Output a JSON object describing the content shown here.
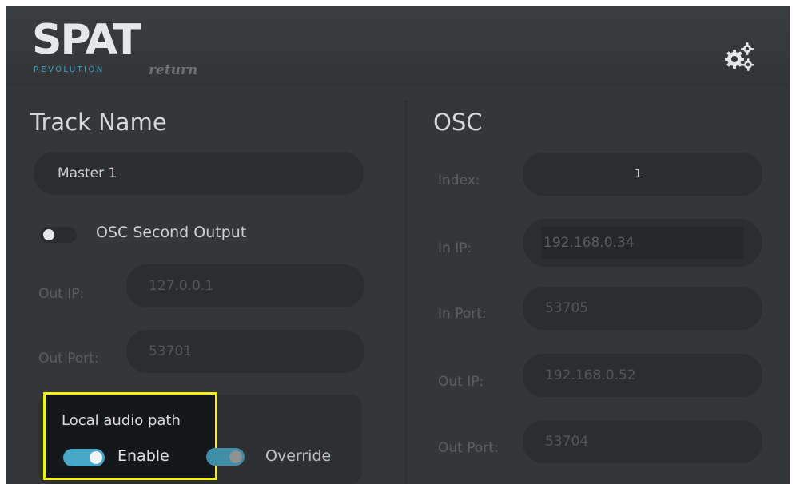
{
  "header": {
    "logo_main": "SPAT",
    "logo_sub": "REVOLUTION",
    "logo_return": "return",
    "settings_icon": "gears-icon"
  },
  "left": {
    "heading": "Track Name",
    "track_name_value": "Master 1",
    "osc_second_output": {
      "label": "OSC Second Output",
      "enabled": false
    },
    "out_ip": {
      "label": "Out IP:",
      "value": "127.0.0.1"
    },
    "out_port": {
      "label": "Out Port:",
      "value": "53701"
    },
    "local_audio_path": {
      "title": "Local audio path",
      "enable": {
        "label": "Enable",
        "on": true
      },
      "override": {
        "label": "Override",
        "on": true
      }
    }
  },
  "right": {
    "heading": "OSC",
    "index": {
      "label": "Index:",
      "value": "1"
    },
    "in_ip": {
      "label": "In IP:",
      "value": "192.168.0.34"
    },
    "in_port": {
      "label": "In Port:",
      "value": "53705"
    },
    "out_ip": {
      "label": "Out IP:",
      "value": "192.168.0.52"
    },
    "out_port": {
      "label": "Out Port:",
      "value": "53704"
    }
  },
  "colors": {
    "background": "#34363a",
    "field": "#2c2d30",
    "accent": "#3ba5c8",
    "highlight": "#f2f20c"
  }
}
